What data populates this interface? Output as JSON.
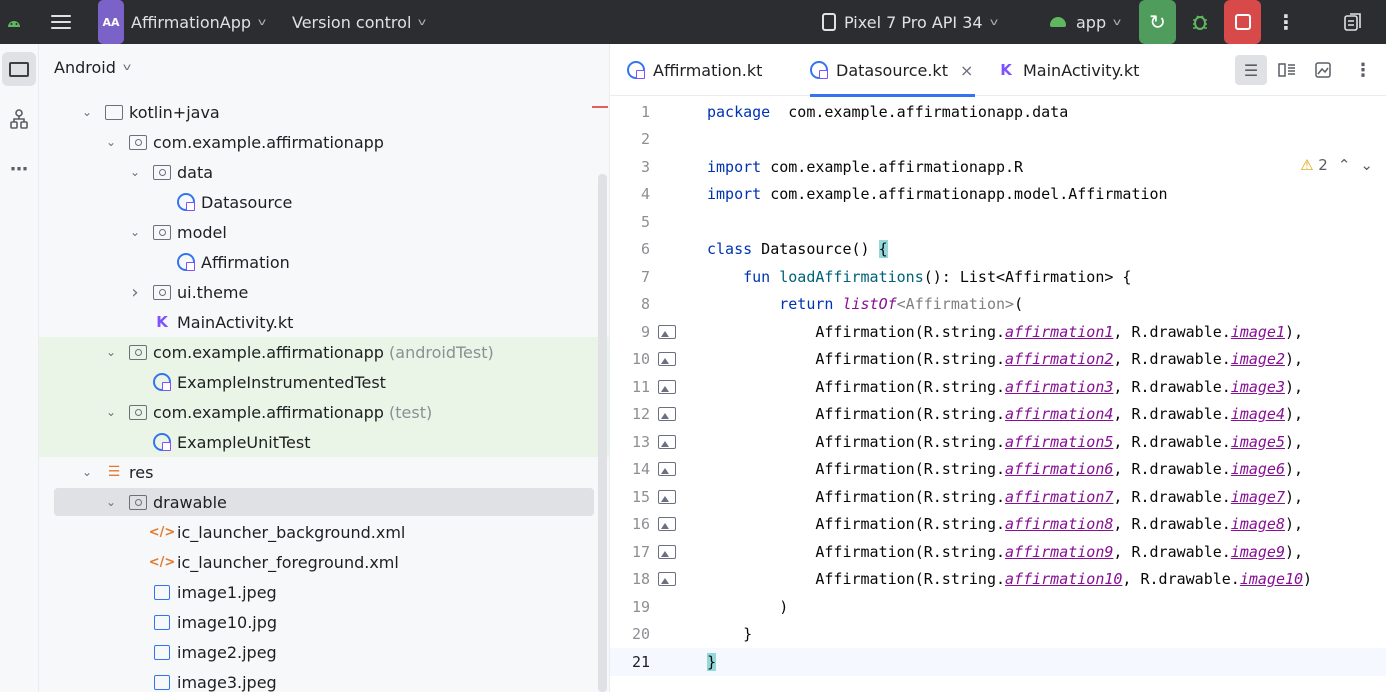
{
  "titlebar": {
    "project_badge": "AA",
    "project_name": "AffirmationApp",
    "vcs_label": "Version control",
    "device": "Pixel 7 Pro API 34",
    "run_config": "app",
    "icons": [
      "android-icon",
      "hamburger-icon",
      "phone-icon",
      "rerun-icon",
      "debug-icon",
      "stop-icon",
      "more-icon",
      "assistant-icon"
    ],
    "colors": {
      "background": "#2b2d30",
      "rerun": "#4f9c5d",
      "stop": "#d84a49",
      "project_badge": "#7b62c9"
    }
  },
  "project_panel": {
    "view_label": "Android",
    "tree": [
      {
        "label": "kotlin+java",
        "sub": "",
        "depth": 0,
        "expanded": true,
        "icon": "folder-icon"
      },
      {
        "label": "com.example.affirmationapp",
        "sub": "",
        "depth": 1,
        "expanded": true,
        "icon": "package-icon"
      },
      {
        "label": "data",
        "sub": "",
        "depth": 2,
        "expanded": true,
        "icon": "package-icon"
      },
      {
        "label": "Datasource",
        "sub": "",
        "depth": 3,
        "icon": "kotlin-class-icon"
      },
      {
        "label": "model",
        "sub": "",
        "depth": 2,
        "expanded": true,
        "icon": "package-icon"
      },
      {
        "label": "Affirmation",
        "sub": "",
        "depth": 3,
        "icon": "kotlin-class-icon"
      },
      {
        "label": "ui.theme",
        "sub": "",
        "depth": 2,
        "expanded": false,
        "icon": "package-icon"
      },
      {
        "label": "MainActivity.kt",
        "sub": "",
        "depth": 2,
        "icon": "kotlin-file-icon"
      },
      {
        "label": "com.example.affirmationapp",
        "sub": "(androidTest)",
        "depth": 1,
        "expanded": true,
        "icon": "package-icon",
        "green": true
      },
      {
        "label": "ExampleInstrumentedTest",
        "sub": "",
        "depth": 2,
        "icon": "kotlin-class-icon",
        "green": true
      },
      {
        "label": "com.example.affirmationapp",
        "sub": "(test)",
        "depth": 1,
        "expanded": true,
        "icon": "package-icon",
        "green": true
      },
      {
        "label": "ExampleUnitTest",
        "sub": "",
        "depth": 2,
        "icon": "kotlin-class-icon",
        "green": true
      },
      {
        "label": "res",
        "sub": "",
        "depth": 0,
        "expanded": true,
        "icon": "res-folder-icon"
      },
      {
        "label": "drawable",
        "sub": "",
        "depth": 1,
        "expanded": true,
        "icon": "package-icon",
        "selected": true
      },
      {
        "label": "ic_launcher_background.xml",
        "sub": "",
        "depth": 2,
        "icon": "xml-icon"
      },
      {
        "label": "ic_launcher_foreground.xml",
        "sub": "",
        "depth": 2,
        "icon": "xml-icon"
      },
      {
        "label": "image1.jpeg",
        "sub": "",
        "depth": 2,
        "icon": "image-icon"
      },
      {
        "label": "image10.jpg",
        "sub": "",
        "depth": 2,
        "icon": "image-icon"
      },
      {
        "label": "image2.jpeg",
        "sub": "",
        "depth": 2,
        "icon": "image-icon"
      },
      {
        "label": "image3.jpeg",
        "sub": "",
        "depth": 2,
        "icon": "image-icon"
      }
    ]
  },
  "editor": {
    "tabs": [
      {
        "label": "Affirmation.kt",
        "active": false,
        "icon": "kotlin-class-icon"
      },
      {
        "label": "Datasource.kt",
        "active": true,
        "icon": "kotlin-class-icon",
        "closable": true
      },
      {
        "label": "MainActivity.kt",
        "active": false,
        "icon": "kotlin-file-icon"
      }
    ],
    "warning_count": "2",
    "caret_line": 21,
    "gutter_image_lines": [
      9,
      10,
      11,
      12,
      13,
      14,
      15,
      16,
      17,
      18
    ],
    "code_lines": [
      [
        [
          "kw",
          "package"
        ],
        [
          "",
          "  com.example.affirmationapp.data"
        ]
      ],
      [],
      [
        [
          "kw",
          "import"
        ],
        [
          "",
          " com.example.affirmationapp.R"
        ]
      ],
      [
        [
          "kw",
          "import"
        ],
        [
          "",
          " com.example.affirmationapp.model.Affirmation"
        ]
      ],
      [],
      [
        [
          "kw",
          "class"
        ],
        [
          "",
          " Datasource() "
        ],
        [
          "brace-hl",
          "{"
        ]
      ],
      [
        [
          "",
          "    "
        ],
        [
          "kw",
          "fun"
        ],
        [
          "",
          " "
        ],
        [
          "fn",
          "loadAffirmations"
        ],
        [
          "",
          "(): List<Affirmation> {"
        ]
      ],
      [
        [
          "",
          "        "
        ],
        [
          "kw",
          "return"
        ],
        [
          "",
          " "
        ],
        [
          "it",
          "listOf"
        ],
        [
          "gen",
          "<Affirmation>"
        ],
        [
          "",
          "("
        ]
      ],
      [
        [
          "",
          "            Affirmation(R.string."
        ],
        [
          "ref",
          "affirmation1"
        ],
        [
          "",
          ", R.drawable."
        ],
        [
          "ref",
          "image1"
        ],
        [
          "",
          "),"
        ]
      ],
      [
        [
          "",
          "            Affirmation(R.string."
        ],
        [
          "ref",
          "affirmation2"
        ],
        [
          "",
          ", R.drawable."
        ],
        [
          "ref",
          "image2"
        ],
        [
          "",
          "),"
        ]
      ],
      [
        [
          "",
          "            Affirmation(R.string."
        ],
        [
          "ref",
          "affirmation3"
        ],
        [
          "",
          ", R.drawable."
        ],
        [
          "ref",
          "image3"
        ],
        [
          "",
          "),"
        ]
      ],
      [
        [
          "",
          "            Affirmation(R.string."
        ],
        [
          "ref",
          "affirmation4"
        ],
        [
          "",
          ", R.drawable."
        ],
        [
          "ref",
          "image4"
        ],
        [
          "",
          "),"
        ]
      ],
      [
        [
          "",
          "            Affirmation(R.string."
        ],
        [
          "ref",
          "affirmation5"
        ],
        [
          "",
          ", R.drawable."
        ],
        [
          "ref",
          "image5"
        ],
        [
          "",
          "),"
        ]
      ],
      [
        [
          "",
          "            Affirmation(R.string."
        ],
        [
          "ref",
          "affirmation6"
        ],
        [
          "",
          ", R.drawable."
        ],
        [
          "ref",
          "image6"
        ],
        [
          "",
          "),"
        ]
      ],
      [
        [
          "",
          "            Affirmation(R.string."
        ],
        [
          "ref",
          "affirmation7"
        ],
        [
          "",
          ", R.drawable."
        ],
        [
          "ref",
          "image7"
        ],
        [
          "",
          "),"
        ]
      ],
      [
        [
          "",
          "            Affirmation(R.string."
        ],
        [
          "ref",
          "affirmation8"
        ],
        [
          "",
          ", R.drawable."
        ],
        [
          "ref",
          "image8"
        ],
        [
          "",
          "),"
        ]
      ],
      [
        [
          "",
          "            Affirmation(R.string."
        ],
        [
          "ref",
          "affirmation9"
        ],
        [
          "",
          ", R.drawable."
        ],
        [
          "ref",
          "image9"
        ],
        [
          "",
          "),"
        ]
      ],
      [
        [
          "",
          "            Affirmation(R.string."
        ],
        [
          "ref",
          "affirmation10"
        ],
        [
          "",
          ", R.drawable."
        ],
        [
          "ref",
          "image10"
        ],
        [
          "",
          ")"
        ]
      ],
      [
        [
          "",
          "        )"
        ]
      ],
      [
        [
          "",
          "    }"
        ]
      ],
      [
        [
          "brace-hl",
          "}"
        ]
      ]
    ]
  }
}
